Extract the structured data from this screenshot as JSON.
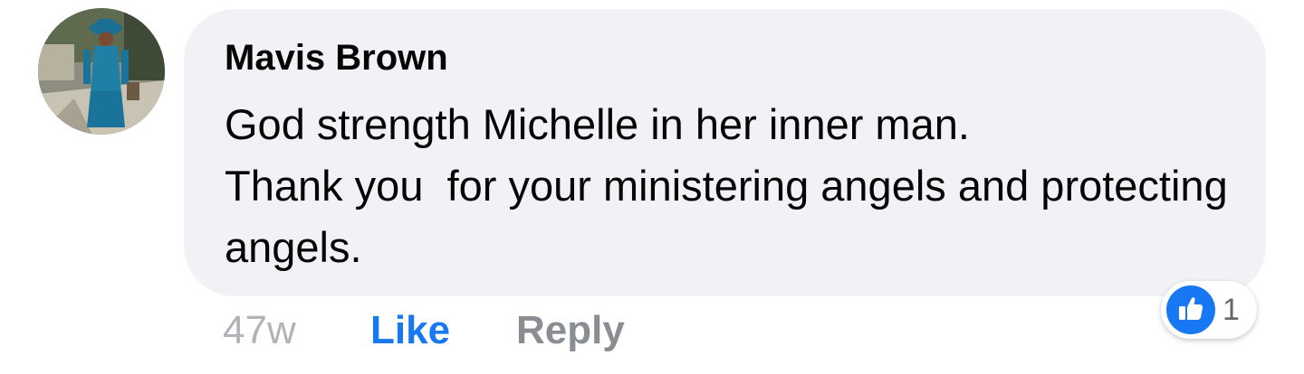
{
  "comment": {
    "author": "Mavis Brown",
    "text": "God strength Michelle in her inner man.\nThank you  for your ministering angels and protecting angels.",
    "timestamp": "47w",
    "like_label": "Like",
    "reply_label": "Reply",
    "reactions": {
      "icon": "thumbs-up-icon",
      "count": "1"
    }
  },
  "colors": {
    "bubble": "#f0f2f5",
    "like_blue": "#1877f2",
    "muted": "#8a8d91"
  }
}
